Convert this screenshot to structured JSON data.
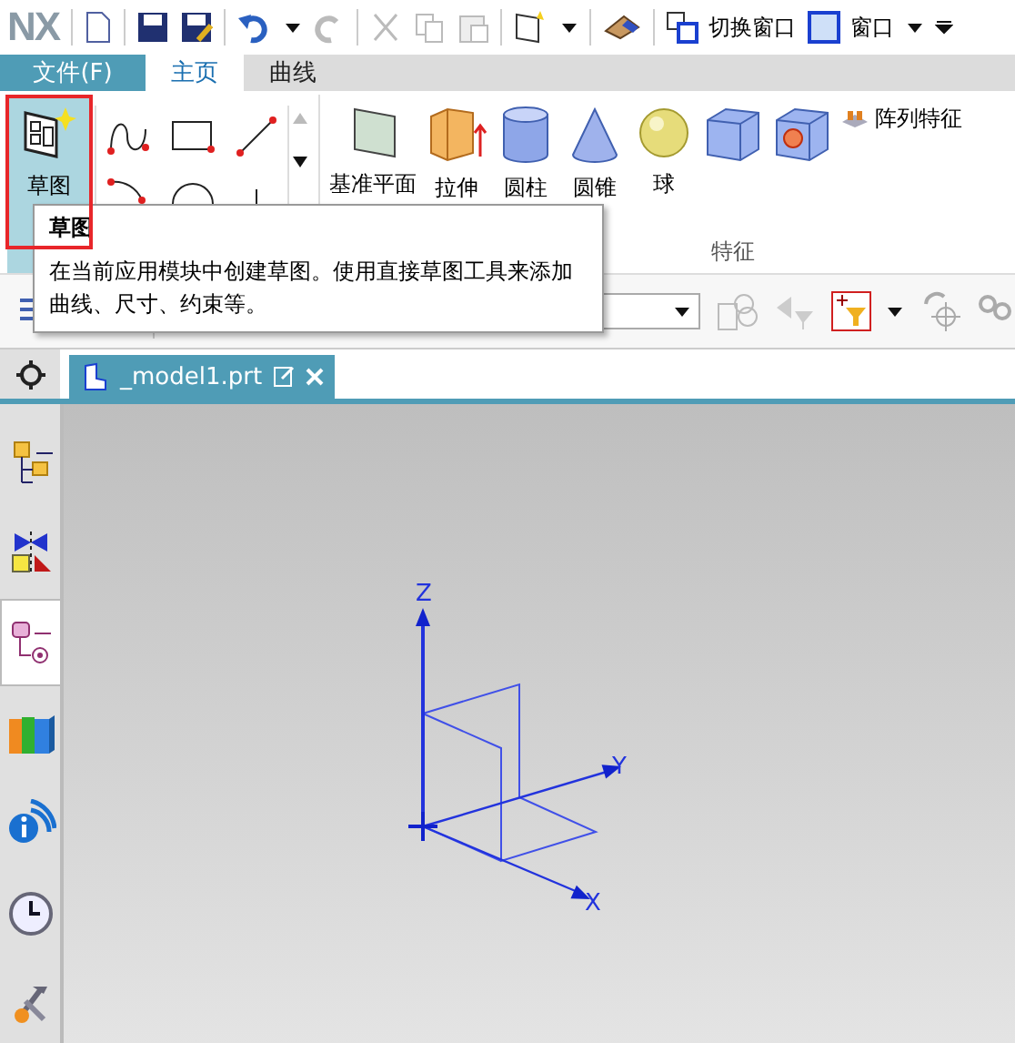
{
  "quick_access": {
    "logo": "NX",
    "switch_window": "切换窗口",
    "window_menu": "窗口"
  },
  "tabs": [
    {
      "label": "文件(F)",
      "kind": "file",
      "selected": false
    },
    {
      "label": "主页",
      "kind": "tab",
      "selected": true
    },
    {
      "label": "曲线",
      "kind": "tab",
      "selected": false
    }
  ],
  "ribbon": {
    "sketch": {
      "label": "草图",
      "highlighted": true
    },
    "features": [
      {
        "kind": "plane",
        "label": "基准平面"
      },
      {
        "kind": "extrude",
        "label": "拉伸"
      },
      {
        "kind": "cylinder",
        "label": "圆柱"
      },
      {
        "kind": "cone",
        "label": "圆锥"
      },
      {
        "kind": "sphere",
        "label": "球"
      },
      {
        "kind": "block"
      },
      {
        "kind": "hole"
      }
    ],
    "pattern_feature": "阵列特征",
    "group_label": "特征"
  },
  "tooltip": {
    "title": "草图",
    "text": "在当前应用模块中创建草图。使用直接草图工具来添加曲线、尺寸、约束等。"
  },
  "document_tab": {
    "label": "_model1.prt"
  },
  "resource_bar": [
    {
      "kind": "assembly",
      "selected": false
    },
    {
      "kind": "constraint",
      "selected": false
    },
    {
      "kind": "part",
      "selected": true
    },
    {
      "kind": "library",
      "selected": false
    },
    {
      "kind": "info",
      "selected": false
    },
    {
      "kind": "history",
      "selected": false
    },
    {
      "kind": "roles",
      "selected": false
    }
  ],
  "viewport": {
    "axes": [
      {
        "kind": "z",
        "label": "Z"
      },
      {
        "kind": "y",
        "label": "Y"
      },
      {
        "kind": "x",
        "label": "X"
      }
    ]
  }
}
